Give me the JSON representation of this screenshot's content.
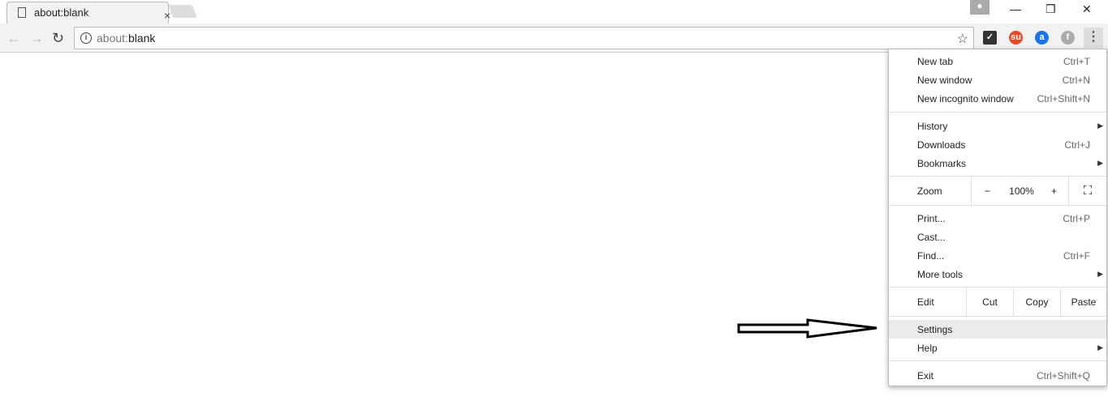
{
  "tab": {
    "title": "about:blank",
    "close": "×"
  },
  "window": {
    "minimize": "—",
    "restore": "❐",
    "close": "✕"
  },
  "omnibox": {
    "value_prefix": "about:",
    "value_main": "blank"
  },
  "extensions": [
    {
      "name": "checkmark",
      "color": "#333333"
    },
    {
      "name": "stumbleupon",
      "color": "#eb4924"
    },
    {
      "name": "amazon-assistant",
      "color": "#1a73e8"
    },
    {
      "name": "grey-extension",
      "color": "#aaaaaa"
    }
  ],
  "menu": {
    "new_tab": "New tab",
    "new_tab_sc": "Ctrl+T",
    "new_window": "New window",
    "new_window_sc": "Ctrl+N",
    "incognito": "New incognito window",
    "incognito_sc": "Ctrl+Shift+N",
    "history": "History",
    "downloads": "Downloads",
    "downloads_sc": "Ctrl+J",
    "bookmarks": "Bookmarks",
    "zoom": "Zoom",
    "zoom_minus": "−",
    "zoom_value": "100%",
    "zoom_plus": "+",
    "print": "Print...",
    "print_sc": "Ctrl+P",
    "cast": "Cast...",
    "find": "Find...",
    "find_sc": "Ctrl+F",
    "more_tools": "More tools",
    "edit": "Edit",
    "cut": "Cut",
    "copy": "Copy",
    "paste": "Paste",
    "settings": "Settings",
    "help": "Help",
    "exit": "Exit",
    "exit_sc": "Ctrl+Shift+Q"
  }
}
